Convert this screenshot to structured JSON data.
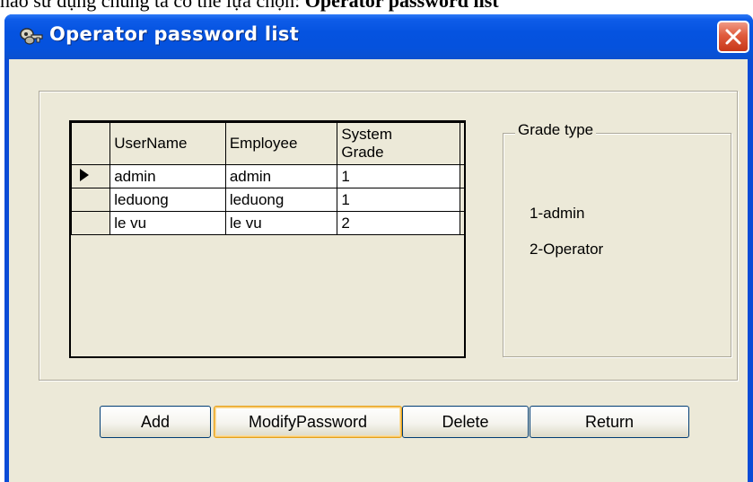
{
  "document": {
    "prefix": "nào sử dụng chúng ta có thể lựa chọn: ",
    "bold": "Operator password list"
  },
  "window": {
    "title": "Operator password list",
    "icon": "keys-icon",
    "close_icon": "close-icon",
    "colors": {
      "titlebar": "#0553e0",
      "client": "#ece9d8",
      "close": "#e05b3d"
    }
  },
  "grid": {
    "columns": [
      "UserName",
      "Employee",
      "System Grade"
    ],
    "rows": [
      {
        "username": "admin",
        "employee": "admin",
        "grade": "1",
        "current": true
      },
      {
        "username": "leduong",
        "employee": "leduong",
        "grade": "1",
        "current": false
      },
      {
        "username": "le vu",
        "employee": "le vu",
        "grade": "2",
        "current": false
      }
    ]
  },
  "grade_type": {
    "title": "Grade type",
    "items": [
      "1-admin",
      "2-Operator"
    ]
  },
  "buttons": {
    "add": "Add",
    "modify": "ModifyPassword",
    "delete": "Delete",
    "return": "Return"
  }
}
